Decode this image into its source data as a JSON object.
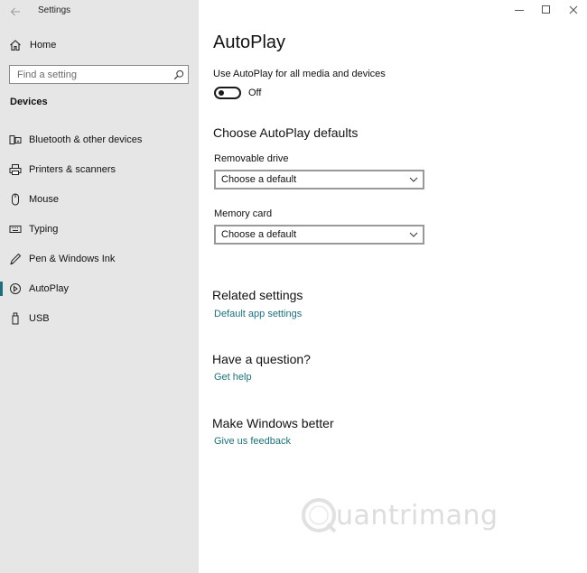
{
  "window": {
    "title": "Settings"
  },
  "sidebar": {
    "home_label": "Home",
    "search_placeholder": "Find a setting",
    "section_title": "Devices",
    "items": [
      {
        "label": "Bluetooth & other devices",
        "icon": "bluetooth-devices-icon"
      },
      {
        "label": "Printers & scanners",
        "icon": "printer-icon"
      },
      {
        "label": "Mouse",
        "icon": "mouse-icon"
      },
      {
        "label": "Typing",
        "icon": "keyboard-icon"
      },
      {
        "label": "Pen & Windows Ink",
        "icon": "pen-icon"
      },
      {
        "label": "AutoPlay",
        "icon": "autoplay-icon",
        "selected": true
      },
      {
        "label": "USB",
        "icon": "usb-icon"
      }
    ]
  },
  "main": {
    "title": "AutoPlay",
    "toggle": {
      "caption": "Use AutoPlay for all media and devices",
      "state_label": "Off",
      "on": false
    },
    "defaults_heading": "Choose AutoPlay defaults",
    "removable": {
      "label": "Removable drive",
      "value": "Choose a default"
    },
    "memory": {
      "label": "Memory card",
      "value": "Choose a default"
    },
    "related": {
      "heading": "Related settings",
      "link": "Default app settings"
    },
    "question": {
      "heading": "Have a question?",
      "link": "Get help"
    },
    "better": {
      "heading": "Make Windows better",
      "link": "Give us feedback"
    }
  },
  "watermark": {
    "text": "uantrimang"
  },
  "colors": {
    "accent": "#1f6f7a",
    "sidebar_bg": "#e6e6e6"
  }
}
